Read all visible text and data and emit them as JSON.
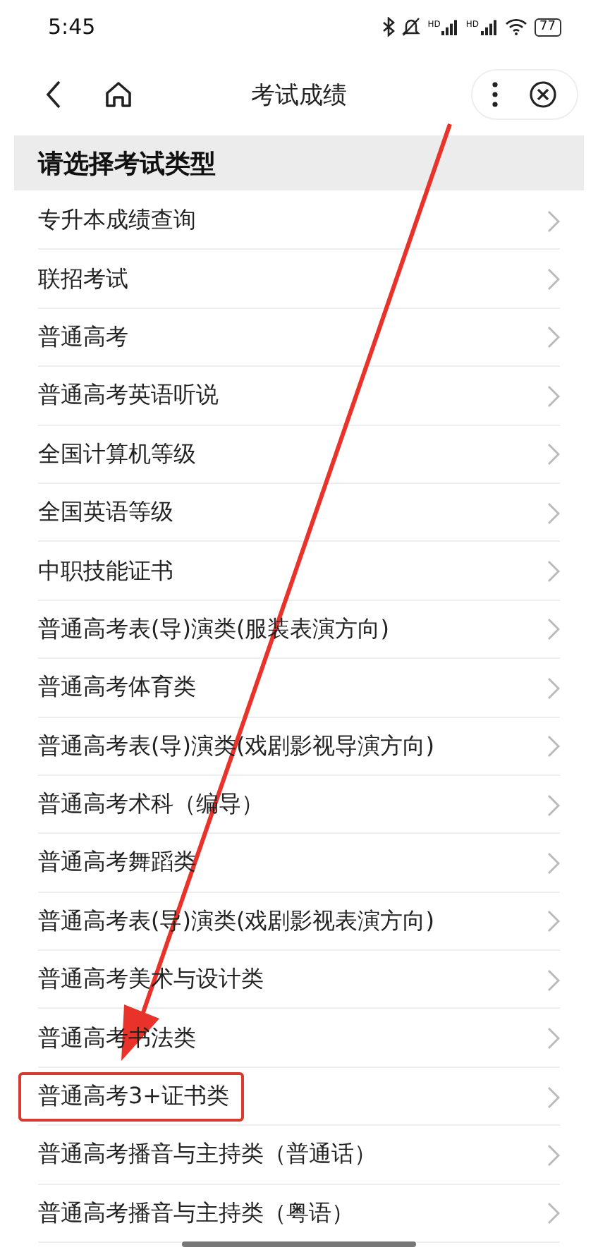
{
  "status_bar": {
    "time": "5:45",
    "signals": [
      {
        "label": "HD"
      },
      {
        "label": "HD"
      }
    ],
    "battery": "77"
  },
  "nav": {
    "title": "考试成绩"
  },
  "section_title": "请选择考试类型",
  "items": [
    {
      "label": "专升本成绩查询",
      "highlighted": false
    },
    {
      "label": "联招考试",
      "highlighted": false
    },
    {
      "label": "普通高考",
      "highlighted": false
    },
    {
      "label": "普通高考英语听说",
      "highlighted": false
    },
    {
      "label": "全国计算机等级",
      "highlighted": false
    },
    {
      "label": "全国英语等级",
      "highlighted": false
    },
    {
      "label": "中职技能证书",
      "highlighted": false
    },
    {
      "label": "普通高考表(导)演类(服装表演方向)",
      "highlighted": false
    },
    {
      "label": "普通高考体育类",
      "highlighted": false
    },
    {
      "label": "普通高考表(导)演类(戏剧影视导演方向)",
      "highlighted": false
    },
    {
      "label": "普通高考术科（编导）",
      "highlighted": false
    },
    {
      "label": "普通高考舞蹈类",
      "highlighted": false
    },
    {
      "label": "普通高考表(导)演类(戏剧影视表演方向)",
      "highlighted": false
    },
    {
      "label": "普通高考美术与设计类",
      "highlighted": false
    },
    {
      "label": "普通高考书法类",
      "highlighted": false
    },
    {
      "label": "普通高考3+证书类",
      "highlighted": true
    },
    {
      "label": "普通高考播音与主持类（普通话）",
      "highlighted": false
    },
    {
      "label": "普通高考播音与主持类（粤语）",
      "highlighted": false
    }
  ]
}
